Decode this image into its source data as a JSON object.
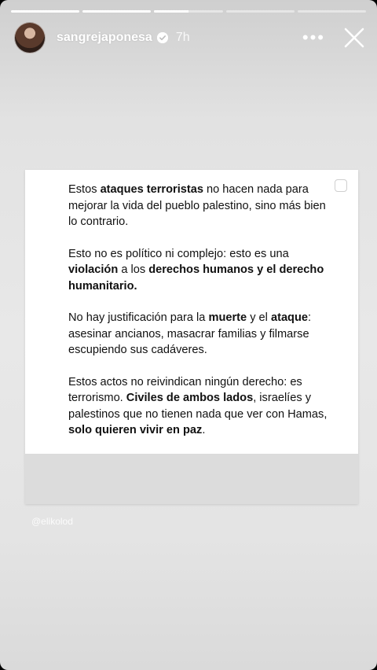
{
  "story": {
    "progress_segments": [
      1,
      1,
      0.5,
      0,
      0
    ],
    "username": "sangrejaponesa",
    "verified": true,
    "timestamp": "7h",
    "more_label": "•••",
    "close_label": "✕"
  },
  "post": {
    "paragraphs": [
      [
        {
          "t": "Estos ",
          "b": false
        },
        {
          "t": "ataques terroristas",
          "b": true
        },
        {
          "t": " no hacen nada para mejorar la vida del pueblo palestino, sino más bien lo contrario.",
          "b": false
        }
      ],
      [
        {
          "t": "Esto no es político ni complejo: esto es una ",
          "b": false
        },
        {
          "t": "violación",
          "b": true
        },
        {
          "t": " a los ",
          "b": false
        },
        {
          "t": "derechos humanos y el derecho humanitario.",
          "b": true
        }
      ],
      [
        {
          "t": "No hay justificación para la ",
          "b": false
        },
        {
          "t": "muerte",
          "b": true
        },
        {
          "t": " y el ",
          "b": false
        },
        {
          "t": "ataque",
          "b": true
        },
        {
          "t": ": asesinar ancianos, masacrar familias y filmarse escupiendo sus cadáveres.",
          "b": false
        }
      ],
      [
        {
          "t": "Estos actos no reivindican ningún derecho: es terrorismo. ",
          "b": false
        },
        {
          "t": "Civiles de ambos lados",
          "b": true
        },
        {
          "t": ", israelíes y palestinos que no tienen nada que ver con Hamas, ",
          "b": false
        },
        {
          "t": "solo quieren vivir en paz",
          "b": true
        },
        {
          "t": ".",
          "b": false
        }
      ]
    ]
  },
  "watermark": "@elikolod"
}
